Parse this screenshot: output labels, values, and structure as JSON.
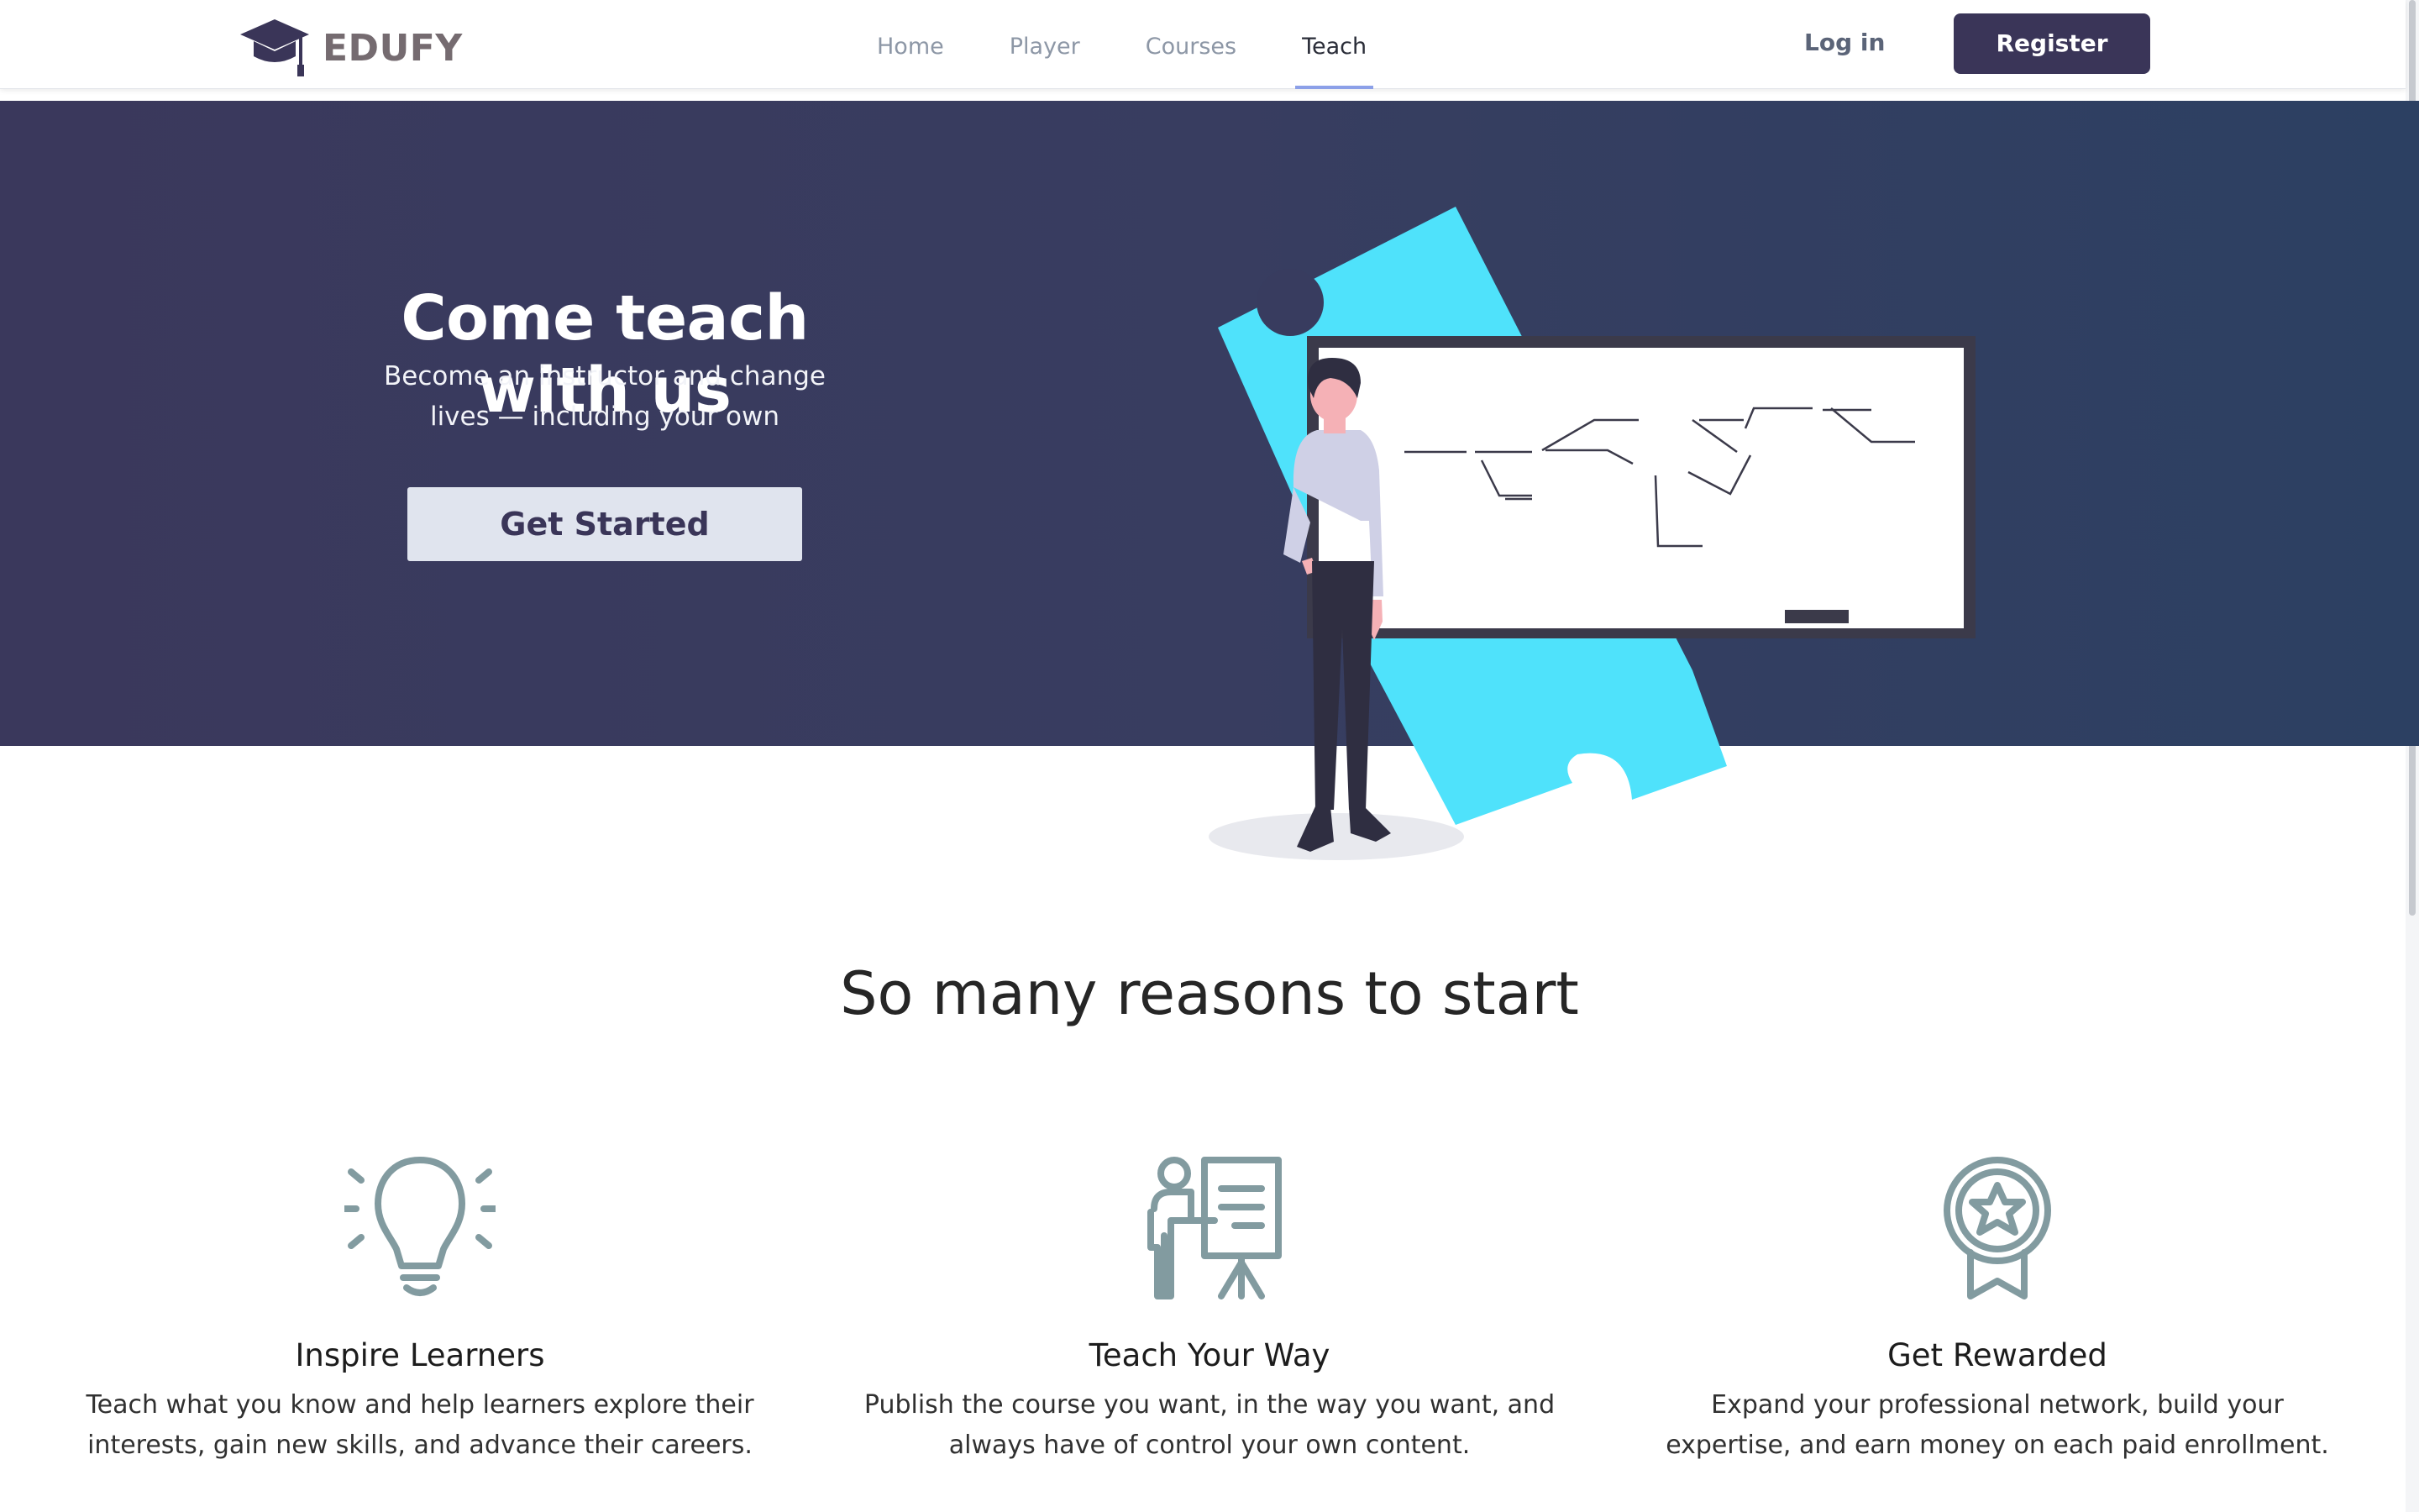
{
  "brand": {
    "name": "EDUFY",
    "icon": "graduation-cap-icon"
  },
  "nav": {
    "links": [
      {
        "label": "Home",
        "active": false
      },
      {
        "label": "Player",
        "active": false
      },
      {
        "label": "Courses",
        "active": false
      },
      {
        "label": "Teach",
        "active": true
      }
    ],
    "login_label": "Log in",
    "register_label": "Register"
  },
  "hero": {
    "title": "Come teach with us",
    "subtitle_line1": "Become an instructor and change",
    "subtitle_line2": "lives — including your own",
    "cta_label": "Get Started"
  },
  "reasons": {
    "title": "So many reasons to start",
    "items": [
      {
        "icon": "lightbulb-icon",
        "title": "Inspire Learners",
        "desc_line1": "Teach what you know and help learners explore their",
        "desc_line2": "interests, gain new skills, and advance their careers."
      },
      {
        "icon": "teacher-board-icon",
        "title": "Teach Your Way",
        "desc_line1": "Publish the course you want, in the way you want, and",
        "desc_line2": "always have of control your own content."
      },
      {
        "icon": "award-badge-icon",
        "title": "Get Rewarded",
        "desc_line1": "Expand your professional network, build your",
        "desc_line2": "expertise, and earn money on each paid enrollment."
      }
    ]
  },
  "colors": {
    "brand_dark": "#3a3558",
    "hero_start": "#3a385c",
    "hero_end": "#2c4062",
    "accent_cyan": "#4fe2fb",
    "icon_gray": "#829ba0",
    "nav_underline": "#8ca0e8"
  }
}
